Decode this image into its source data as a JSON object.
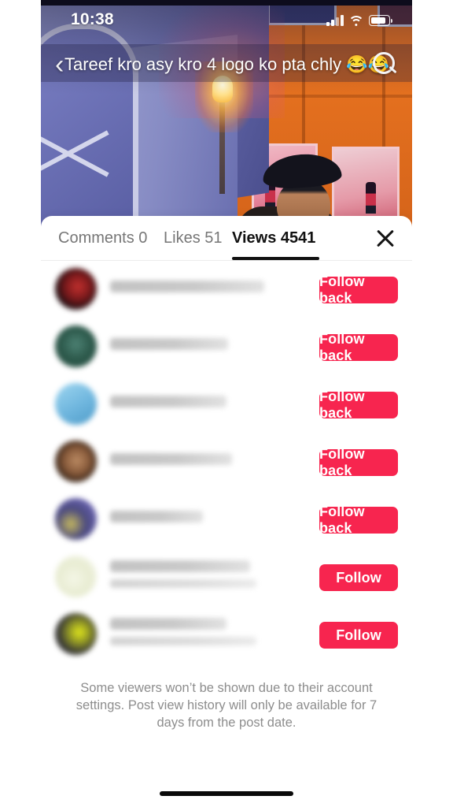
{
  "status_bar": {
    "time": "10:38",
    "icons": [
      "signal-bars-icon",
      "wifi-icon",
      "battery-icon"
    ],
    "battery_level_pct": 84
  },
  "video": {
    "caption": "Tareef kro asy kro 4 logo ko pta chly 😂😂",
    "back_icon": "back-chevron-icon",
    "search_icon": "search-icon"
  },
  "sheet": {
    "tabs": [
      {
        "label": "Comments 0",
        "active": false
      },
      {
        "label": "Likes 51",
        "active": false
      },
      {
        "label": "Views 4541",
        "active": true
      }
    ],
    "close_icon": "close-icon",
    "footer_note": "Some viewers won’t be shown due to their account settings. Post view history will only be available for 7 days from the post date."
  },
  "viewers": [
    {
      "name": "",
      "subtitle": "",
      "button": "Follow back",
      "avatar_colors": [
        "#2a1014",
        "#c2302e",
        "#120d10"
      ]
    },
    {
      "name": "",
      "subtitle": "",
      "button": "Follow back",
      "avatar_colors": [
        "#2f5c4e",
        "#1d4438",
        "#3b6f5d"
      ]
    },
    {
      "name": "",
      "subtitle": "",
      "button": "Follow back",
      "avatar_colors": [
        "#89ccea",
        "#5aa8d4",
        "#bfe1f2"
      ]
    },
    {
      "name": "",
      "subtitle": "",
      "button": "Follow back",
      "avatar_colors": [
        "#2a1c16",
        "#a77a58",
        "#120c0a"
      ]
    },
    {
      "name": "",
      "subtitle": "",
      "button": "Follow back",
      "avatar_colors": [
        "#6b64b4",
        "#3f3d6e",
        "#c6b95e"
      ]
    },
    {
      "name": "",
      "subtitle": "",
      "button": "Follow",
      "avatar_colors": [
        "#eef0e2",
        "#e2e6cf",
        "#f6f7f0"
      ]
    },
    {
      "name": "",
      "subtitle": "",
      "button": "Follow",
      "avatar_colors": [
        "#2b2b2b",
        "#e2e81c",
        "#5a5a55"
      ]
    }
  ],
  "colors": {
    "accent_red": "#f7254f",
    "active_tab": "#111111",
    "inactive_tab": "#767676",
    "footer_text": "#8d8d8d"
  }
}
